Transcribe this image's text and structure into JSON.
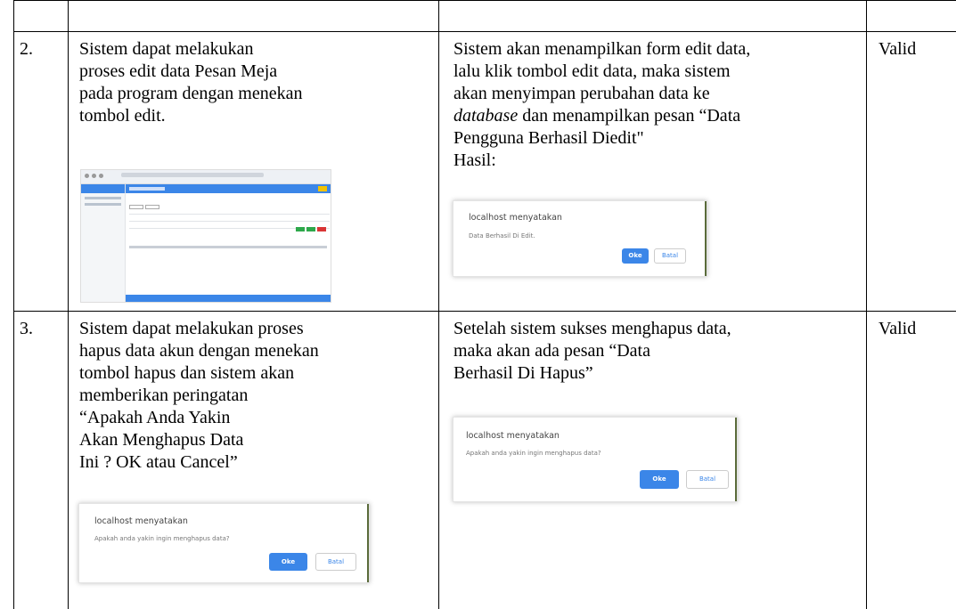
{
  "rows": [
    {
      "no": "2.",
      "desc": [
        "Sistem dapat melakukan",
        "proses edit data Pesan Meja",
        "pada program dengan menekan",
        "tombol edit."
      ],
      "result": [
        "Sistem akan menampilkan form edit data,",
        "lalu klik tombol edit data, maka sistem",
        "akan menyimpan perubahan data ke"
      ],
      "result_italic": "database",
      "result_after_italic": " dan menampilkan pesan “Data",
      "result_tail": [
        "Pengguna Berhasil Diedit\"",
        "Hasil:"
      ],
      "status": "Valid",
      "dialog": {
        "title": "localhost menyatakan",
        "message": "Data Berhasil Di Edit.",
        "ok": "Oke",
        "cancel": "Batal"
      }
    },
    {
      "no": "3.",
      "desc": [
        "Sistem dapat melakukan proses",
        "hapus data akun dengan menekan",
        "tombol hapus dan sistem akan",
        "memberikan peringatan",
        "“Apakah Anda Yakin",
        "Akan Menghapus Data",
        "Ini ? OK atau Cancel”"
      ],
      "result": [
        "Setelah sistem sukses menghapus data,",
        "maka akan ada pesan “Data",
        "Berhasil Di Hapus”"
      ],
      "status": "Valid",
      "dialog": {
        "title": "localhost menyatakan",
        "message": "Apakah anda yakin ingin menghapus data?",
        "ok": "Oke",
        "cancel": "Batal"
      }
    }
  ]
}
